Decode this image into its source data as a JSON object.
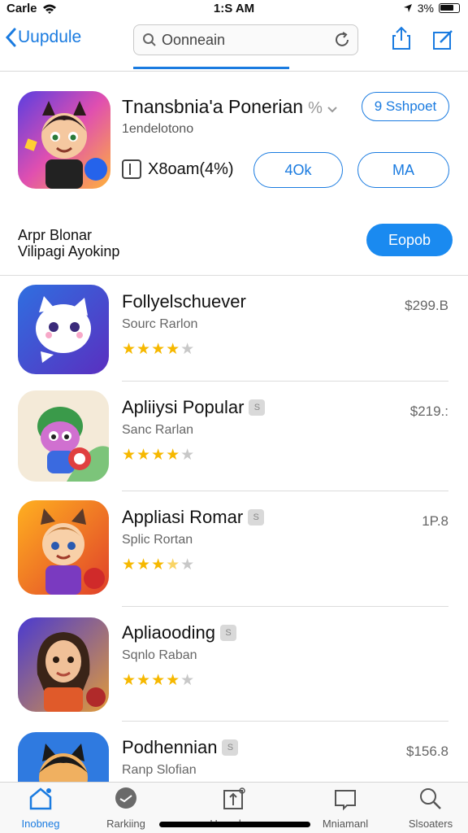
{
  "status_bar": {
    "carrier": "Carle",
    "time": "1:S AM",
    "battery": "3%"
  },
  "nav": {
    "back_label": "Uupdule",
    "search_value": "Oonneain"
  },
  "featured": {
    "title": "Tnansbnia'a Ponerian",
    "title_suffix": "%",
    "subtitle": "1endelotono",
    "price_text": "X8oam(4%)",
    "action_button": "9 Sshpoet",
    "pill_1": "4Ok",
    "pill_2": "MA",
    "colors": {
      "icon_bg": "#6b4fe0"
    }
  },
  "section": {
    "title_line1": "Arpr Blonar",
    "title_line2": "Vilipagi Ayokinp",
    "button": "Eopob"
  },
  "apps": [
    {
      "name": "Follyelschuever",
      "subtitle": "Sourc Rarlon",
      "price": "$299.B",
      "rating": 4,
      "badge": ""
    },
    {
      "name": "Apliiysi Popular",
      "subtitle": "Sanc Rarlan",
      "price": "$219.:",
      "rating": 4,
      "badge": "S"
    },
    {
      "name": "Appliasi Romar",
      "subtitle": "Splic Rortan",
      "price": "1P.8",
      "rating": 3.5,
      "badge": "S"
    },
    {
      "name": "Apliaooding",
      "subtitle": "Sqnlo Raban",
      "price": "",
      "rating": 4,
      "badge": "S"
    },
    {
      "name": "Podhennian",
      "subtitle": "Ranp Slofian",
      "price": "$156.8",
      "rating": 0,
      "badge": "S"
    }
  ],
  "tabs": [
    {
      "label": "Inobneg",
      "icon": "home-icon",
      "active": true
    },
    {
      "label": "Rarkiing",
      "icon": "chat-icon",
      "active": false
    },
    {
      "label": "Ueeadoes",
      "icon": "updates-icon",
      "active": false
    },
    {
      "label": "Mniamanl",
      "icon": "inbox-icon",
      "active": false
    },
    {
      "label": "Slsoaters",
      "icon": "search-icon",
      "active": false
    }
  ],
  "colors": {
    "accent": "#1a7be0",
    "star": "#f6b800"
  }
}
